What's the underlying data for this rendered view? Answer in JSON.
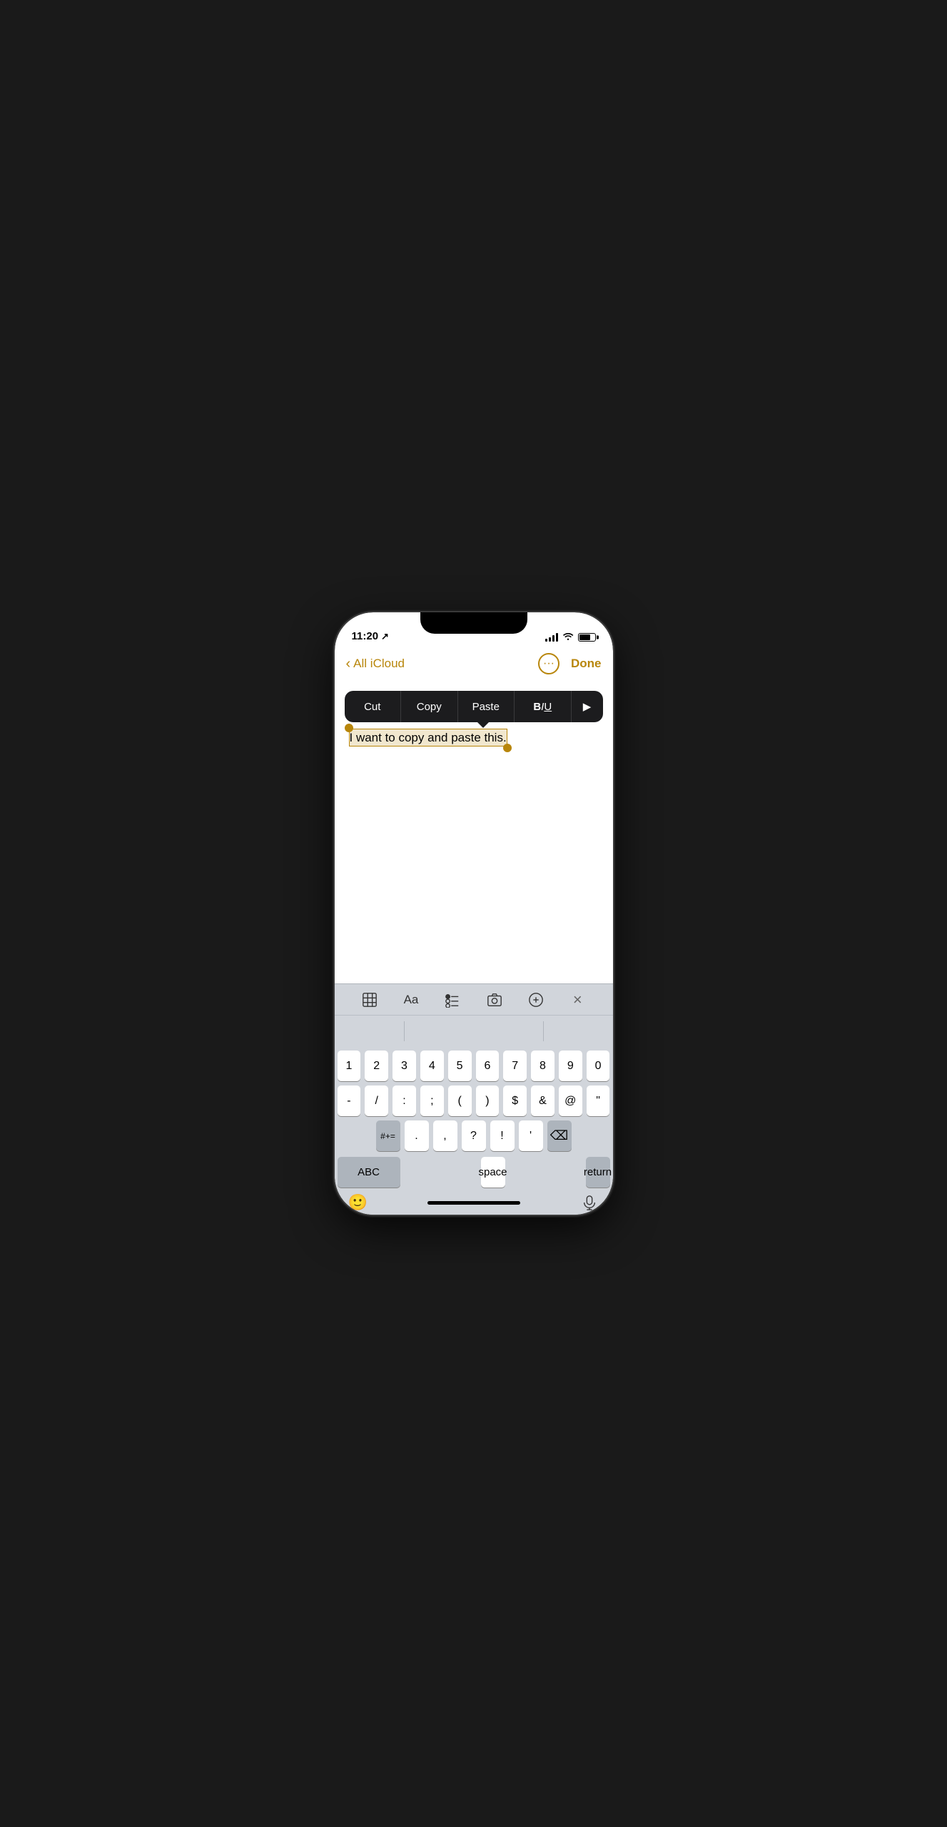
{
  "status": {
    "time": "11:20",
    "location_arrow": "↗"
  },
  "nav": {
    "back_label": "All iCloud",
    "done_label": "Done"
  },
  "context_menu": {
    "cut": "Cut",
    "copy": "Copy",
    "paste": "Paste",
    "biu": "BIU",
    "more_arrow": "▶"
  },
  "editor": {
    "selected_text": "I want to copy and paste this."
  },
  "keyboard_toolbar": {
    "table_icon": "table",
    "font_icon": "Aa",
    "checklist_icon": "checklist",
    "camera_icon": "camera",
    "compose_icon": "compose",
    "close_icon": "×"
  },
  "keyboard": {
    "row1": [
      "1",
      "2",
      "3",
      "4",
      "5",
      "6",
      "7",
      "8",
      "9",
      "0"
    ],
    "row2": [
      "-",
      "/",
      ":",
      ";",
      "(",
      ")",
      "$",
      "&",
      "@",
      "\""
    ],
    "row3_left": "#+=",
    "row3_mid": [
      ".",
      ",",
      "?",
      "!",
      "'"
    ],
    "row3_right": "⌫",
    "space_label": "space",
    "abc_label": "ABC",
    "return_label": "return"
  }
}
